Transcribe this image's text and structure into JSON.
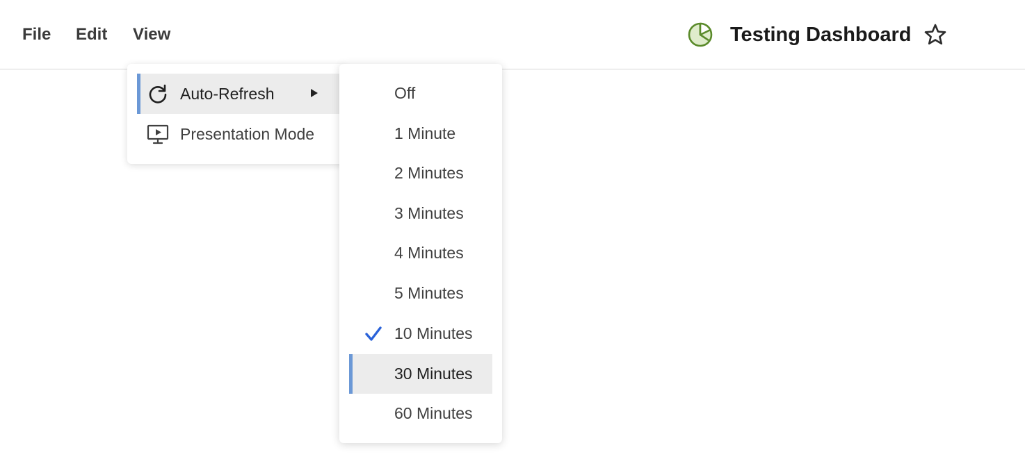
{
  "menubar": {
    "file": "File",
    "edit": "Edit",
    "view": "View"
  },
  "dashboard": {
    "title": "Testing Dashboard",
    "icon": "pie-chart-icon",
    "icon_color": "#5a8a2a",
    "favorite_icon": "star-outline-icon"
  },
  "view_menu": {
    "items": [
      {
        "label": "Auto-Refresh",
        "icon": "refresh-icon",
        "has_submenu": true,
        "active": true
      },
      {
        "label": "Presentation Mode",
        "icon": "presentation-monitor-icon",
        "has_submenu": false,
        "active": false
      }
    ]
  },
  "auto_refresh_menu": {
    "selected": "10 Minutes",
    "hovered": "30 Minutes",
    "check_color": "#2a62d9",
    "accent_color": "#6b98d6",
    "options": [
      {
        "label": "Off"
      },
      {
        "label": "1 Minute"
      },
      {
        "label": "2 Minutes"
      },
      {
        "label": "3 Minutes"
      },
      {
        "label": "4 Minutes"
      },
      {
        "label": "5 Minutes"
      },
      {
        "label": "10 Minutes"
      },
      {
        "label": "30 Minutes"
      },
      {
        "label": "60 Minutes"
      }
    ]
  }
}
